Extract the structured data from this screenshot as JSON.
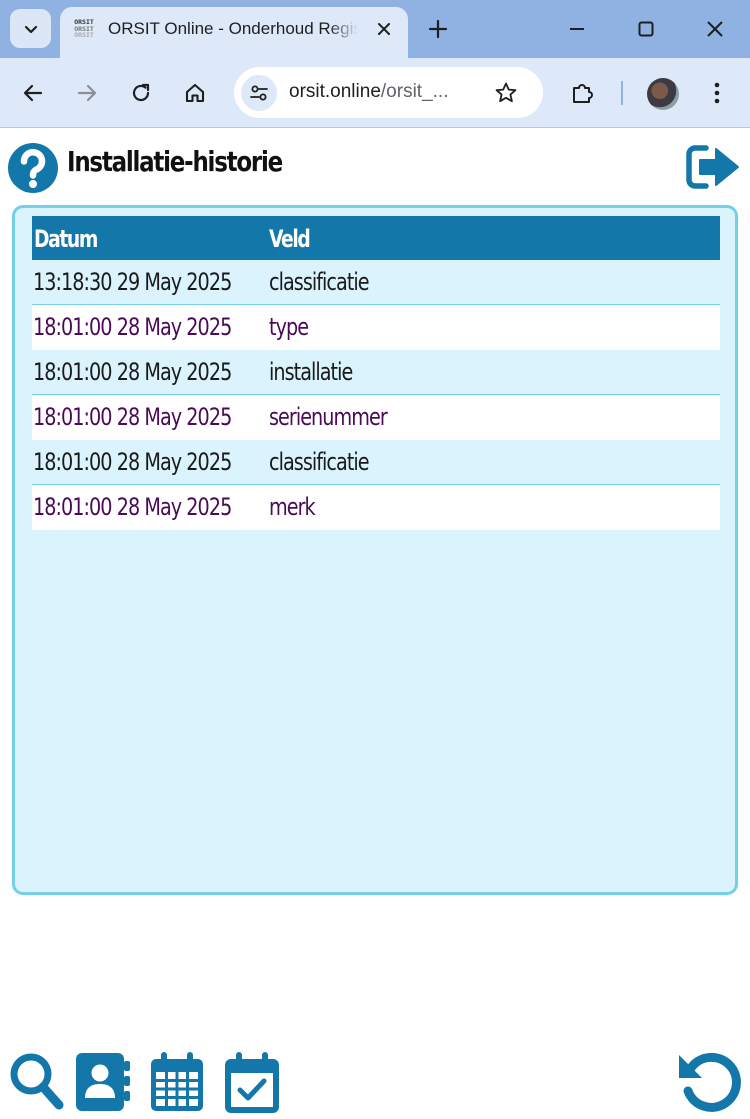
{
  "browser": {
    "tab_title": "ORSIT Online - Onderhoud Registratie",
    "url_host": "orsit.online",
    "url_path": "/orsit_...",
    "favicon_text": [
      "ORSIT",
      "ORSIT",
      "ORSIT"
    ]
  },
  "page": {
    "title": "Installatie-historie"
  },
  "table": {
    "headers": {
      "datum": "Datum",
      "veld": "Veld"
    },
    "rows": [
      {
        "datum": "13:18:30 29 May 2025",
        "veld": "classificatie"
      },
      {
        "datum": "18:01:00 28 May 2025",
        "veld": "type"
      },
      {
        "datum": "18:01:00 28 May 2025",
        "veld": "installatie"
      },
      {
        "datum": "18:01:00 28 May 2025",
        "veld": "serienummer"
      },
      {
        "datum": "18:01:00 28 May 2025",
        "veld": "classificatie"
      },
      {
        "datum": "18:01:00 28 May 2025",
        "veld": "merk"
      }
    ]
  },
  "icons": {
    "header": [
      "help-icon",
      "exit-icon"
    ],
    "bottom": [
      "search-icon",
      "contacts-icon",
      "calendar-icon",
      "calendar-check-icon",
      "refresh-icon"
    ]
  },
  "colors": {
    "accent": "#1477a9",
    "panel_bg": "#daf3fc",
    "panel_border": "#74d0e9",
    "alt_row_text": "#4a0a55",
    "browser_frame": "#8fb2e3"
  }
}
